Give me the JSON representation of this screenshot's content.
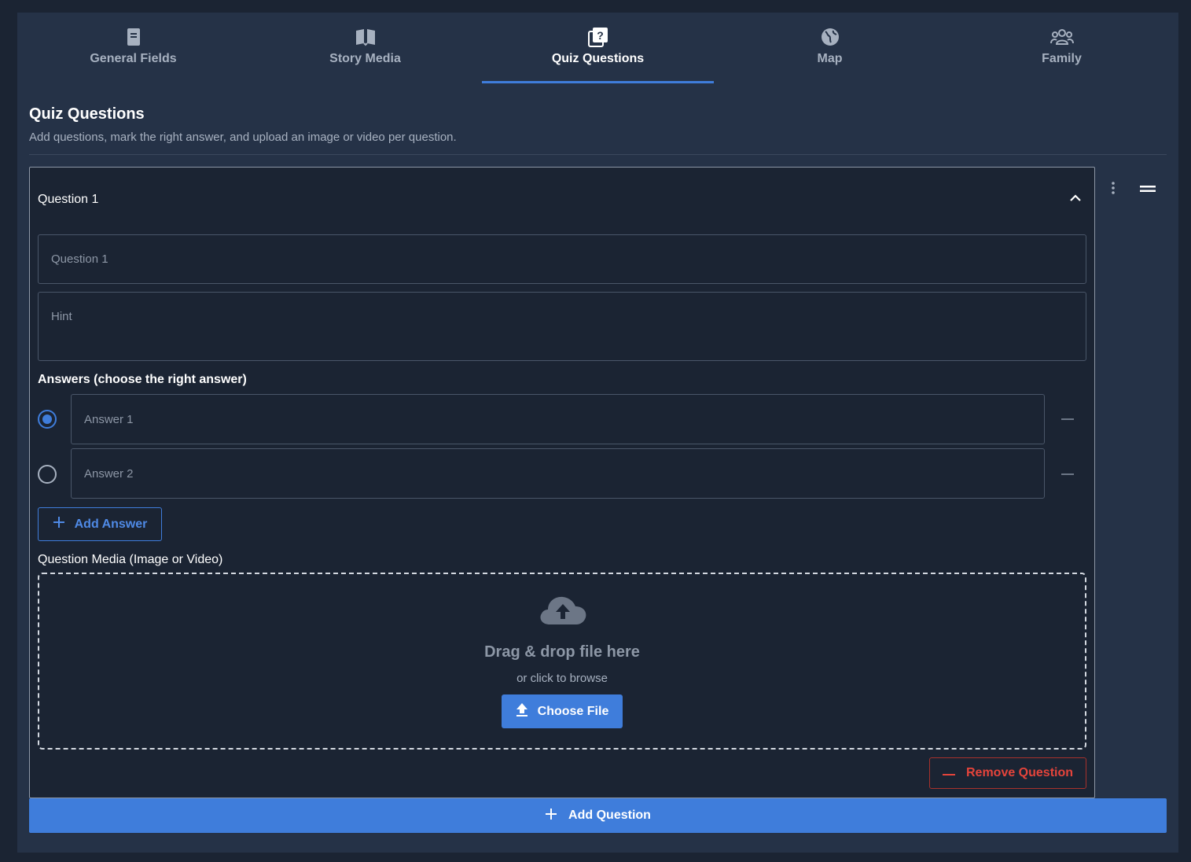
{
  "tabs": [
    {
      "label": "General Fields",
      "icon": "document-icon"
    },
    {
      "label": "Story Media",
      "icon": "book-icon"
    },
    {
      "label": "Quiz Questions",
      "icon": "quiz-icon",
      "active": true
    },
    {
      "label": "Map",
      "icon": "globe-icon"
    },
    {
      "label": "Family",
      "icon": "family-icon"
    }
  ],
  "section": {
    "title": "Quiz Questions",
    "subtitle": "Add questions, mark the right answer, and upload an image or video per question."
  },
  "question": {
    "header": "Question 1",
    "question_placeholder": "Question 1",
    "hint_placeholder": "Hint",
    "answers_label": "Answers (choose the right answer)",
    "answers": [
      {
        "placeholder": "Answer 1",
        "selected": true
      },
      {
        "placeholder": "Answer 2",
        "selected": false
      }
    ],
    "add_answer_label": "Add Answer",
    "media_label": "Question Media (Image or Video)",
    "dropzone": {
      "title": "Drag & drop file here",
      "subtitle": "or click to browse",
      "button_label": "Choose File"
    },
    "remove_label": "Remove Question"
  },
  "add_question_label": "Add Question",
  "colors": {
    "background": "#1b2433",
    "panel": "#253247",
    "accent": "#3f7ddb",
    "danger": "#e5443b"
  }
}
